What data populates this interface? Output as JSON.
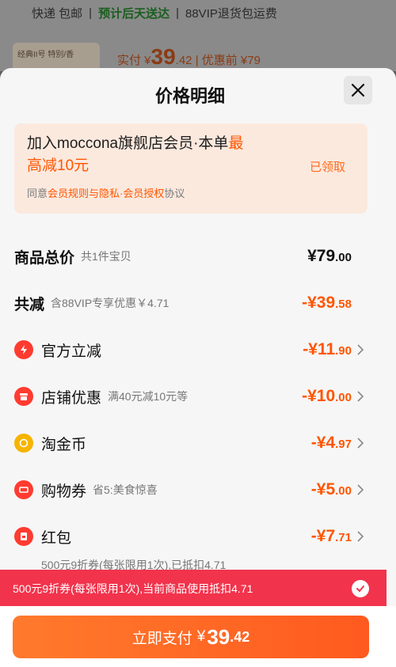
{
  "background": {
    "shipping": "快递 包邮",
    "delivery": "预计后天送达",
    "return": "88VIP退货包运费",
    "thumb_text": "经典II号 特别/香",
    "paid_label": "实付 ¥",
    "paid_int": "39",
    "paid_dec": ".42",
    "before_label": "| 优惠前 ¥79"
  },
  "sheet": {
    "title": "价格明细",
    "close_icon": "close-icon"
  },
  "member": {
    "title_part1": "加入moccona旗舰店会员·本单",
    "title_highlight1": "最",
    "title_highlight2": "高减10元",
    "status": "已领取",
    "agree_prefix": "同意",
    "agree_link": "会员规则与隐私·会员授权",
    "agree_suffix": "协议"
  },
  "rows": {
    "total": {
      "label": "商品总价",
      "sub": "共1件宝贝",
      "int": "¥79",
      "dec": ".00"
    },
    "reduce": {
      "label": "共减",
      "sub": "含88VIP专享优惠￥4.71",
      "int": "-¥39",
      "dec": ".58"
    },
    "official": {
      "label": "官方立减",
      "int": "-¥11",
      "dec": ".90",
      "icon": "lightning-icon"
    },
    "shop": {
      "label": "店铺优惠",
      "sub": "满40元减10元等",
      "int": "-¥10",
      "dec": ".00",
      "icon": "shop-icon"
    },
    "coin": {
      "label": "淘金币",
      "int": "-¥4",
      "dec": ".97",
      "icon": "coin-icon"
    },
    "voucher": {
      "label": "购物券",
      "sub": "省5:美食惊喜",
      "int": "-¥5",
      "dec": ".00",
      "icon": "ticket-icon"
    },
    "redpack": {
      "label": "红包",
      "int": "-¥7",
      "dec": ".71",
      "icon": "redpacket-icon"
    }
  },
  "redpack_note": "500元9折券(每张限用1次),已抵扣4.71",
  "banner": {
    "text": "500元9折券(每张限用1次),当前商品使用抵扣4.71"
  },
  "pay": {
    "label": "立即支付",
    "currency": "¥",
    "int": "39",
    "dec": ".42"
  },
  "colors": {
    "accent": "#ff5500",
    "banner": "#f2334c",
    "button": "#ff6a26"
  }
}
